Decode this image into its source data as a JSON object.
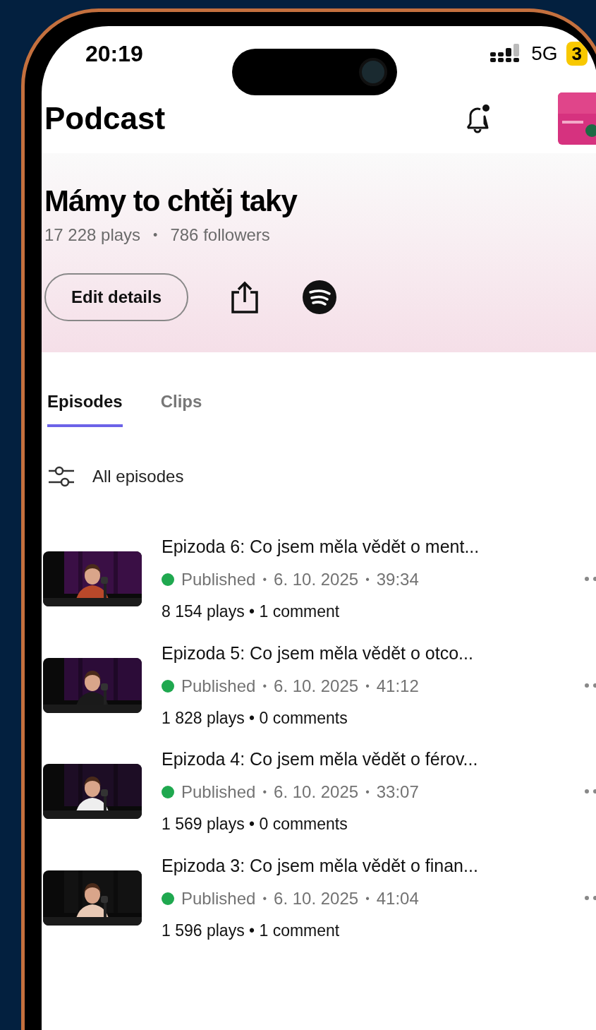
{
  "status_bar": {
    "time": "20:19",
    "network": "5G",
    "battery": "3"
  },
  "header": {
    "title": "Podcast",
    "notification_dot": true
  },
  "podcast": {
    "title": "Mámy to chtěj taky",
    "plays": "17 228 plays",
    "separator": "•",
    "followers": "786 followers",
    "edit_button": "Edit details"
  },
  "tabs": [
    {
      "label": "Episodes",
      "selected": true
    },
    {
      "label": "Clips",
      "selected": false
    }
  ],
  "filter": {
    "label": "All episodes"
  },
  "episodes": [
    {
      "title": "Epizoda 6: Co jsem měla vědět o ment...",
      "status": "Published",
      "color": "#1fa84f",
      "date": "6. 10. 2025",
      "duration": "39:34",
      "stats": "8 154 plays • 1 comment",
      "separator": "•"
    },
    {
      "title": "Epizoda 5: Co jsem měla vědět o otco...",
      "status": "Published",
      "color": "#1fa84f",
      "date": "6. 10. 2025",
      "duration": "41:12",
      "stats": "1 828 plays • 0 comments",
      "separator": "•"
    },
    {
      "title": "Epizoda 4: Co jsem měla vědět o férov...",
      "status": "Published",
      "color": "#1fa84f",
      "date": "6. 10. 2025",
      "duration": "33:07",
      "stats": "1 569 plays • 0 comments",
      "separator": "•"
    },
    {
      "title": "Epizoda 3: Co jsem měla vědět o finan...",
      "status": "Published",
      "color": "#1fa84f",
      "date": "6. 10. 2025",
      "duration": "41:04",
      "stats": "1 596 plays • 1 comment",
      "separator": "•"
    }
  ]
}
